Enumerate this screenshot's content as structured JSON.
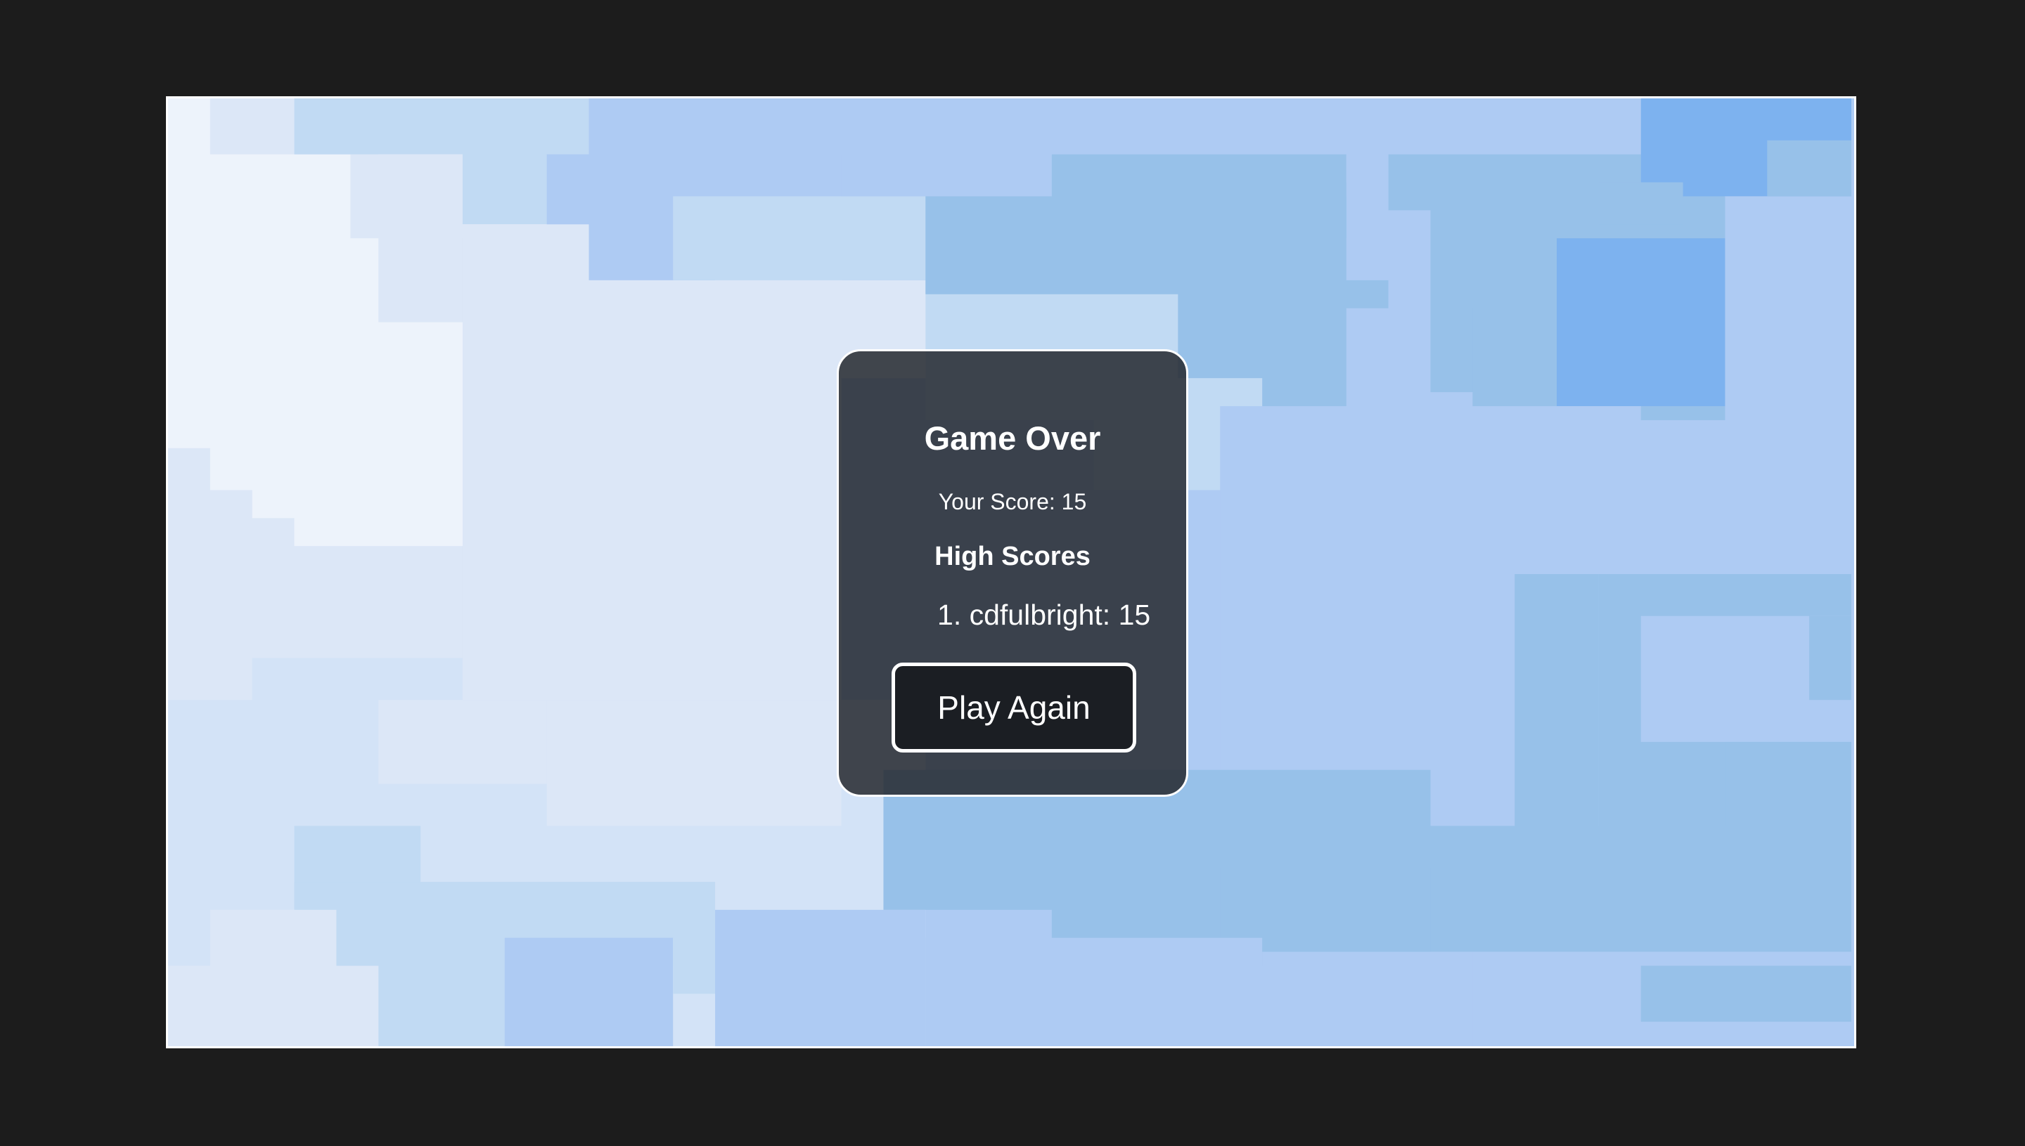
{
  "game_over": {
    "title": "Game Over",
    "score_label": "Your Score:",
    "score": 15,
    "high_scores_title": "High Scores",
    "high_scores": [
      {
        "rank": 1,
        "name": "cdfulbright",
        "score": 15
      }
    ],
    "play_again_label": "Play Again"
  },
  "colors": {
    "page_background": "#1c1c1c",
    "tile_palette": [
      "#edf3fb",
      "#dce7f7",
      "#d3e3f7",
      "#c1daf3",
      "#aecbf3",
      "#97c1e9",
      "#7db2ef"
    ],
    "modal_background": "#262a30",
    "button_background": "#1b1e23",
    "border": "#ffffff"
  }
}
